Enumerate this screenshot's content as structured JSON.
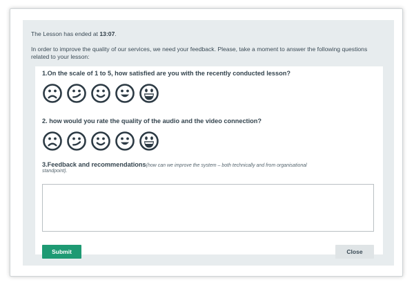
{
  "intro": {
    "ended_prefix": "The Lesson has ended at ",
    "ended_time": "13:07",
    "ended_suffix": ".",
    "text": "In order to improve the quality of our services, we need your feedback. Please, take a moment to answer the following questions related to your lesson:"
  },
  "questions": {
    "q1": "1.On the scale of 1 to 5, how satisfied are you with the recently conducted lesson?",
    "q2": "2. how would you rate the quality of the audio and the video connection?",
    "q3_title": "3.Feedback and recommendations",
    "q3_hint_line1": "(how can we improve the system – both technically and from organisational",
    "q3_hint_line2": "standpoint)."
  },
  "rating_icons": [
    "frowning-face-icon",
    "confused-face-icon",
    "slightly-smiling-face-icon",
    "smiling-face-icon",
    "grinning-face-icon"
  ],
  "feedback": {
    "value": ""
  },
  "buttons": {
    "submit": "Submit",
    "close": "Close"
  },
  "colors": {
    "panel_bg": "#e7ecee",
    "submit_bg": "#1e9a73",
    "close_bg": "#dfe4e6",
    "icon": "#2c3a44"
  }
}
